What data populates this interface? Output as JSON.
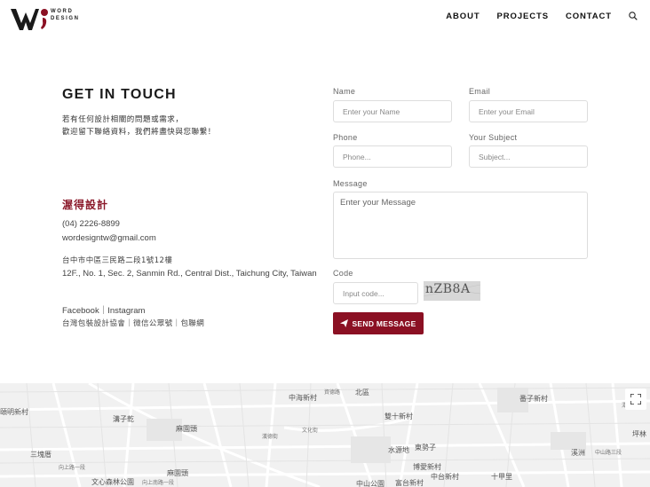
{
  "header": {
    "logo_text_line1": "WORD",
    "logo_text_line2": "DESIGN",
    "nav": [
      "ABOUT",
      "PROJECTS",
      "CONTACT"
    ]
  },
  "contact": {
    "title": "GET IN TOUCH",
    "intro_line1": "若有任何設計相關的問題或需求，",
    "intro_line2": "歡迎留下聯絡資料，我們將盡快與您聯繫！",
    "company": "渥得設計",
    "phone": "(04) 2226-8899",
    "email": "wordesigntw@gmail.com",
    "address_zh": "台中市中區三民路二段1號12樓",
    "address_en": "12F., No. 1, Sec. 2, Sanmin Rd., Central Dist., Taichung City, Taiwan",
    "social_line1": "Facebook｜Instagram",
    "social_line2": "台灣包裝設計協會｜微信公眾號｜包聯網"
  },
  "form": {
    "name_label": "Name",
    "name_placeholder": "Enter your Name",
    "email_label": "Email",
    "email_placeholder": "Enter your Email",
    "phone_label": "Phone",
    "phone_placeholder": "Phone...",
    "subject_label": "Your Subject",
    "subject_placeholder": "Subject...",
    "message_label": "Message",
    "message_placeholder": "Enter your Message",
    "code_label": "Code",
    "code_placeholder": "Input code...",
    "captcha_text": "nZB8A",
    "send_label": "SEND MESSAGE"
  },
  "map": {
    "labels": [
      "中海新村",
      "資德路",
      "北區",
      "番子新村",
      "頤明新村",
      "溝子乾",
      "麻園頭",
      "雙十新村",
      "潭子",
      "文化街",
      "漢德街",
      "三塊厝",
      "向上路一段",
      "水源地",
      "東勢子",
      "博愛新村",
      "溪洲",
      "中山路三段",
      "文心森林公園",
      "向上南路一段",
      "麻園頭",
      "中台新村",
      "十甲里",
      "坪林",
      "中山公園",
      "富台新村"
    ],
    "accent": "#8b1023"
  }
}
